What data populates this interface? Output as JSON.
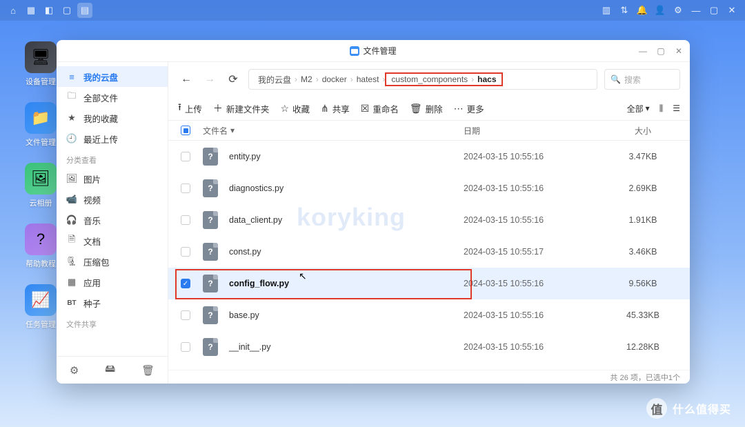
{
  "taskbar": {
    "right_icons": [
      "grid",
      "updown",
      "bell",
      "person",
      "gear",
      "min",
      "max",
      "close"
    ]
  },
  "desktop": [
    {
      "label": "设备管理",
      "color": "linear-gradient(135deg,#393c43,#5a5f68)",
      "glyph": "🖥"
    },
    {
      "label": "文件管理",
      "color": "linear-gradient(135deg,#2f86f3,#4ea0fa)",
      "glyph": "📁"
    },
    {
      "label": "云相册",
      "color": "linear-gradient(135deg,#38c27a,#62d89a)",
      "glyph": "🖼"
    },
    {
      "label": "帮助教程",
      "color": "linear-gradient(135deg,#9f74e8,#b98ef5)",
      "glyph": "?"
    },
    {
      "label": "任务管理",
      "color": "linear-gradient(135deg,#2f86f3,#67b1fb)",
      "glyph": "📈"
    }
  ],
  "window": {
    "title": "文件管理"
  },
  "sidebar": {
    "items": [
      {
        "label": "我的云盘",
        "icon": "≡",
        "active": true
      },
      {
        "label": "全部文件",
        "icon": "🗀"
      },
      {
        "label": "我的收藏",
        "icon": "★"
      },
      {
        "label": "最近上传",
        "icon": "🕘"
      }
    ],
    "section1": "分类查看",
    "cats": [
      {
        "label": "图片",
        "icon": "🖼"
      },
      {
        "label": "视频",
        "icon": "📹"
      },
      {
        "label": "音乐",
        "icon": "🎧"
      },
      {
        "label": "文档",
        "icon": "🗎"
      },
      {
        "label": "压缩包",
        "icon": "🗜"
      },
      {
        "label": "应用",
        "icon": "▦"
      },
      {
        "label": "种子",
        "icon": "BT",
        "prefix": "BT"
      }
    ],
    "section2": "文件共享"
  },
  "breadcrumb": [
    "我的云盘",
    "M2",
    "docker",
    "hatest",
    "custom_components",
    "hacs"
  ],
  "search": {
    "placeholder": "搜索"
  },
  "toolbar": {
    "upload": "上传",
    "newfolder": "新建文件夹",
    "favorite": "收藏",
    "share": "共享",
    "rename": "重命名",
    "delete": "删除",
    "more": "更多",
    "viewAll": "全部"
  },
  "columns": {
    "name": "文件名",
    "date": "日期",
    "size": "大小"
  },
  "files": [
    {
      "name": "entity.py",
      "date": "2024-03-15 10:55:16",
      "size": "3.47KB",
      "selected": false
    },
    {
      "name": "diagnostics.py",
      "date": "2024-03-15 10:55:16",
      "size": "2.69KB",
      "selected": false
    },
    {
      "name": "data_client.py",
      "date": "2024-03-15 10:55:16",
      "size": "1.91KB",
      "selected": false
    },
    {
      "name": "const.py",
      "date": "2024-03-15 10:55:17",
      "size": "3.46KB",
      "selected": false
    },
    {
      "name": "config_flow.py",
      "date": "2024-03-15 10:55:16",
      "size": "9.56KB",
      "selected": true
    },
    {
      "name": "base.py",
      "date": "2024-03-15 10:55:16",
      "size": "45.33KB",
      "selected": false
    },
    {
      "name": "__init__.py",
      "date": "2024-03-15 10:55:16",
      "size": "12.28KB",
      "selected": false
    }
  ],
  "status": "共 26 项，已选中1个",
  "watermark": "koryking",
  "footer": "什么值得买"
}
